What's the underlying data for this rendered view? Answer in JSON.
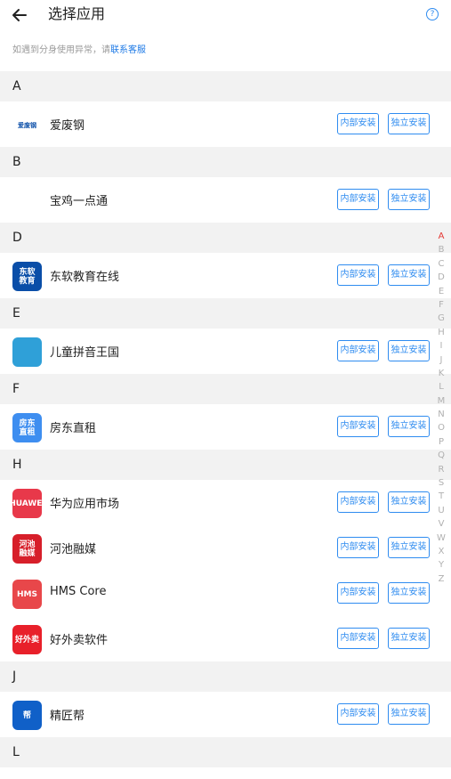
{
  "header": {
    "title": "选择应用",
    "help": "?"
  },
  "hint": {
    "text": "如遇到分身使用异常，请",
    "link": "联系客服"
  },
  "buttons": {
    "inner": "内部安装",
    "standalone": "独立安装"
  },
  "sections": [
    {
      "letter": "A",
      "apps": [
        {
          "name": "爱废钢",
          "icon_label": "爱废钢",
          "color": "#ffffff"
        }
      ]
    },
    {
      "letter": "B",
      "apps": [
        {
          "name": "宝鸡一点通",
          "icon_label": "",
          "color": "#ffffff"
        }
      ]
    },
    {
      "letter": "D",
      "apps": [
        {
          "name": "东软教育在线",
          "icon_label": "东软\n教育",
          "color": "#0a4ea8"
        }
      ]
    },
    {
      "letter": "E",
      "apps": [
        {
          "name": "儿童拼音王国",
          "icon_label": "",
          "color": "#2fa0d8"
        }
      ]
    },
    {
      "letter": "F",
      "apps": [
        {
          "name": "房东直租",
          "icon_label": "房东\n直租",
          "color": "#3e8ef0"
        }
      ]
    },
    {
      "letter": "H",
      "apps": [
        {
          "name": "华为应用市场",
          "icon_label": "HUAWEI",
          "color": "#e8384a"
        },
        {
          "name": "河池融媒",
          "icon_label": "河池\n融媒",
          "color": "#d71f2a"
        },
        {
          "name": "HMS Core",
          "icon_label": "HMS",
          "color": "#e8474a"
        },
        {
          "name": "好外卖软件",
          "icon_label": "好外卖",
          "color": "#e8202a"
        }
      ]
    },
    {
      "letter": "J",
      "apps": [
        {
          "name": "精匠帮",
          "icon_label": "帮",
          "color": "#1060c8"
        }
      ]
    },
    {
      "letter": "L",
      "apps": []
    }
  ],
  "index": [
    "A",
    "B",
    "C",
    "D",
    "E",
    "F",
    "G",
    "H",
    "I",
    "J",
    "K",
    "L",
    "M",
    "N",
    "O",
    "P",
    "Q",
    "R",
    "S",
    "T",
    "U",
    "V",
    "W",
    "X",
    "Y",
    "Z"
  ],
  "index_active": "A"
}
